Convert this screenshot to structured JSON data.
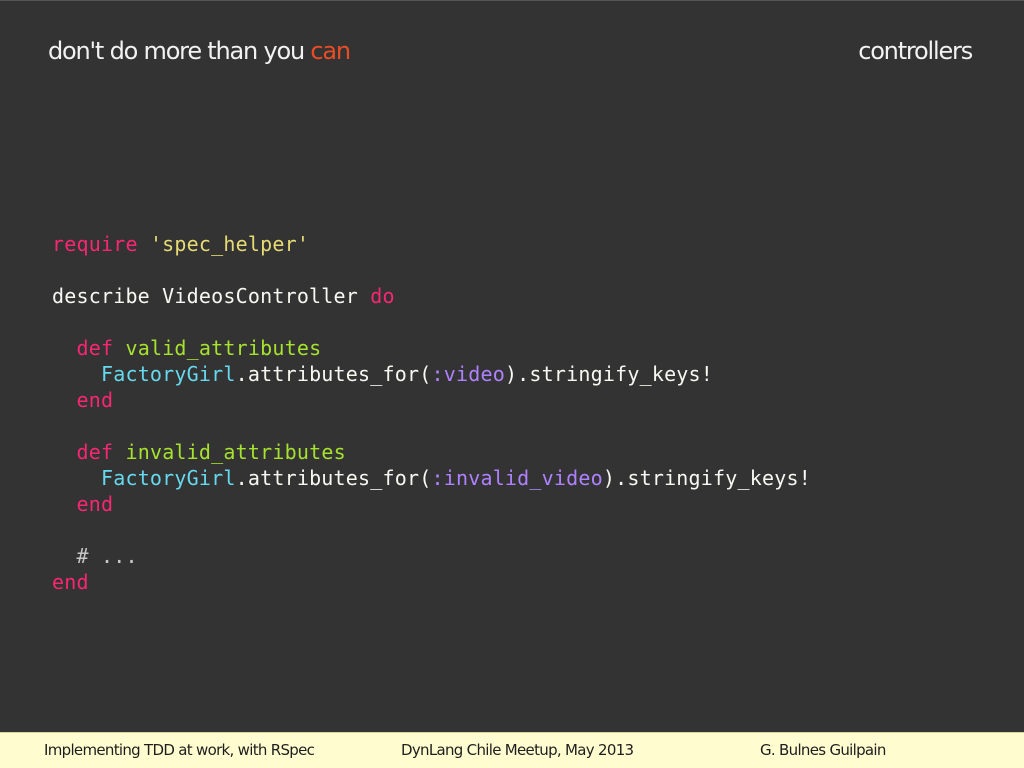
{
  "header": {
    "title_main": "don't do more than you ",
    "title_accent": "can",
    "section": "controllers"
  },
  "code": {
    "language": "ruby",
    "lines": [
      [
        {
          "t": "require",
          "k": "keyword"
        },
        {
          "t": " ",
          "k": "plain"
        },
        {
          "t": "'spec_helper'",
          "k": "string"
        }
      ],
      [],
      [
        {
          "t": "describe VideosController ",
          "k": "plain"
        },
        {
          "t": "do",
          "k": "keyword"
        }
      ],
      [],
      [
        {
          "t": "  ",
          "k": "plain"
        },
        {
          "t": "def",
          "k": "keyword"
        },
        {
          "t": " ",
          "k": "plain"
        },
        {
          "t": "valid_attributes",
          "k": "fn"
        }
      ],
      [
        {
          "t": "    ",
          "k": "plain"
        },
        {
          "t": "FactoryGirl",
          "k": "const"
        },
        {
          "t": ".attributes_for(",
          "k": "plain"
        },
        {
          "t": ":video",
          "k": "symbol"
        },
        {
          "t": ").stringify_keys!",
          "k": "plain"
        }
      ],
      [
        {
          "t": "  ",
          "k": "plain"
        },
        {
          "t": "end",
          "k": "keyword"
        }
      ],
      [],
      [
        {
          "t": "  ",
          "k": "plain"
        },
        {
          "t": "def",
          "k": "keyword"
        },
        {
          "t": " ",
          "k": "plain"
        },
        {
          "t": "invalid_attributes",
          "k": "fn"
        }
      ],
      [
        {
          "t": "    ",
          "k": "plain"
        },
        {
          "t": "FactoryGirl",
          "k": "const"
        },
        {
          "t": ".attributes_for(",
          "k": "plain"
        },
        {
          "t": ":invalid_video",
          "k": "symbol"
        },
        {
          "t": ").stringify_keys!",
          "k": "plain"
        }
      ],
      [
        {
          "t": "  ",
          "k": "plain"
        },
        {
          "t": "end",
          "k": "keyword"
        }
      ],
      [],
      [
        {
          "t": "  # ...",
          "k": "comment"
        }
      ],
      [
        {
          "t": "end",
          "k": "keyword"
        }
      ]
    ]
  },
  "footer": {
    "left": "Implementing TDD at work, with RSpec",
    "middle": "DynLang Chile Meetup, May 2013",
    "right": "G. Bulnes Guilpain"
  },
  "colors": {
    "background": "#333333",
    "accent": "#e94d26",
    "footer_bg": "#fffdd0",
    "keyword": "#f92672",
    "string": "#e6db74",
    "function": "#a6e22e",
    "constant": "#66d9ef",
    "symbol": "#ae81ff"
  }
}
